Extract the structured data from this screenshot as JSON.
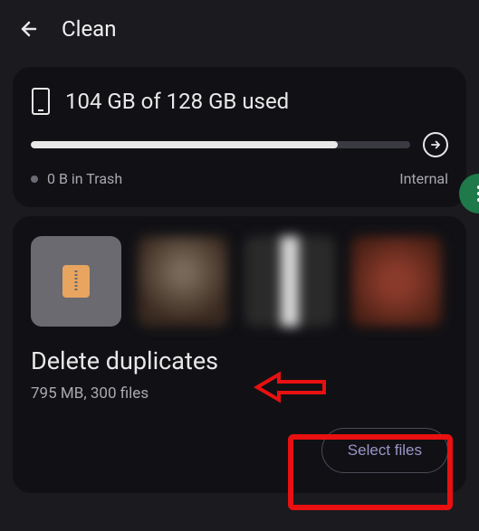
{
  "header": {
    "title": "Clean"
  },
  "storage": {
    "used_text": "104 GB of 128 GB used",
    "progress_percent": 81,
    "trash_text": "0 B in Trash",
    "location": "Internal"
  },
  "duplicates": {
    "title": "Delete duplicates",
    "subtitle": "795 MB, 300 files",
    "button": "Select files"
  }
}
